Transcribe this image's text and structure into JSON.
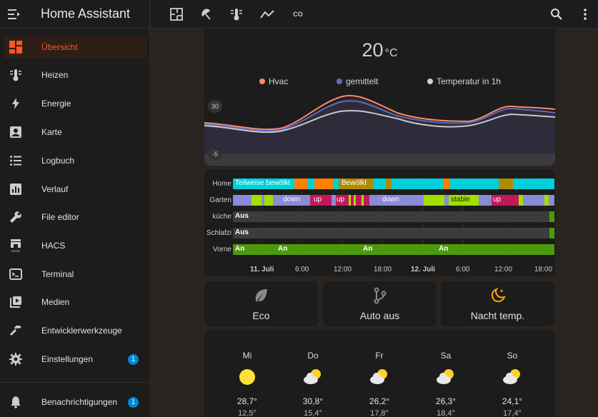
{
  "app": {
    "title": "Home Assistant"
  },
  "sidebar": {
    "items": [
      {
        "label": "Übersicht",
        "icon": "dashboard-icon",
        "active": true
      },
      {
        "label": "Heizen",
        "icon": "thermometer-lines-icon"
      },
      {
        "label": "Energie",
        "icon": "lightning-bolt-icon"
      },
      {
        "label": "Karte",
        "icon": "account-box-icon"
      },
      {
        "label": "Logbuch",
        "icon": "format-list-bulleted-icon"
      },
      {
        "label": "Verlauf",
        "icon": "chart-box-icon"
      },
      {
        "label": "File editor",
        "icon": "wrench-icon"
      },
      {
        "label": "HACS",
        "icon": "hacs-store-icon"
      },
      {
        "label": "Terminal",
        "icon": "console-icon"
      },
      {
        "label": "Medien",
        "icon": "play-box-multiple-icon"
      },
      {
        "label": "Entwicklerwerkzeuge",
        "icon": "hammer-icon"
      },
      {
        "label": "Einstellungen",
        "icon": "cog-icon",
        "badge": "1"
      }
    ],
    "notifications": {
      "label": "Benachrichtigungen",
      "icon": "bell-icon",
      "badge": "1"
    },
    "hacs_caption": "HACS"
  },
  "toolbar": {
    "tabs": [
      "floor-plan-icon",
      "umbrella-icon",
      "thermometer-lines-icon",
      "chart-line-icon",
      "co2-icon"
    ],
    "co2_text": "CO",
    "search_icon": "magnify-icon",
    "menu_icon": "dots-vertical-icon"
  },
  "thermostat": {
    "current": "20",
    "unit": "°C",
    "legend": [
      {
        "name": "Hvac",
        "color": "#ff8a65"
      },
      {
        "name": "gemittelt",
        "color": "#5c6bc0"
      },
      {
        "name": "Temperatur in 1h",
        "color": "#d0d0d0"
      }
    ],
    "axis_top": "30",
    "axis_bottom": "-5"
  },
  "history": {
    "rows": [
      {
        "label": "Home",
        "texts": [
          "Teilweise bewölkt",
          "Bewölkt"
        ]
      },
      {
        "label": "Garten",
        "texts": [
          "down",
          "up",
          "up",
          "down",
          "stable",
          "up"
        ]
      },
      {
        "label": "küche",
        "texts": [
          "Aus"
        ]
      },
      {
        "label": "Schlafzi",
        "texts": [
          "Aus"
        ]
      },
      {
        "label": "Vorne",
        "texts": [
          "An",
          "An",
          "An",
          "An"
        ]
      }
    ],
    "xticks": [
      "11. Juli",
      "6:00",
      "12:00",
      "18:00",
      "12. Juli",
      "6:00",
      "12:00",
      "18:00"
    ],
    "colors": {
      "cyan": "#00d0d8",
      "orange": "#ff8000",
      "olive": "#b08a00",
      "lavender": "#8a8ad8",
      "lime": "#a0e000",
      "magenta": "#c2185b",
      "gray": "#3c3c3c",
      "green": "#4c9a0c"
    }
  },
  "buttons": [
    {
      "label": "Eco",
      "icon": "leaf-icon",
      "color": "#8a8a8a"
    },
    {
      "label": "Auto aus",
      "icon": "source-branch-icon",
      "color": "#8a8a8a"
    },
    {
      "label": "Nacht temp.",
      "icon": "weather-night-icon",
      "color": "#ffa600"
    }
  ],
  "weather": [
    {
      "day": "Mi",
      "icon": "sunny-icon",
      "high": "28,7°",
      "low": "12,5°"
    },
    {
      "day": "Do",
      "icon": "partly-cloudy-icon",
      "high": "30,8°",
      "low": "15,4°"
    },
    {
      "day": "Fr",
      "icon": "partly-cloudy-icon",
      "high": "26,2°",
      "low": "17,8°"
    },
    {
      "day": "Sa",
      "icon": "partly-cloudy-icon",
      "high": "26,3°",
      "low": "18,4°"
    },
    {
      "day": "So",
      "icon": "partly-cloudy-icon",
      "high": "24,1°",
      "low": "17,4°"
    }
  ]
}
